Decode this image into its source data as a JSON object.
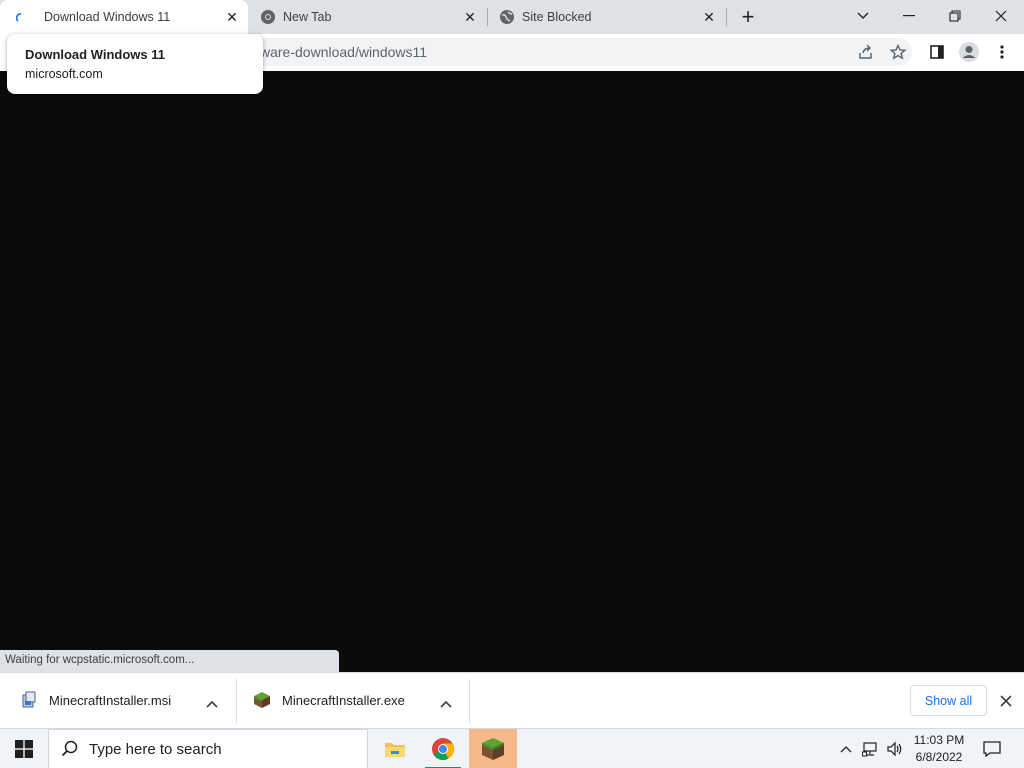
{
  "browser": {
    "tabs": [
      {
        "title": "Download Windows 11",
        "active": true,
        "icon": "loading-spinner-icon"
      },
      {
        "title": "New Tab",
        "active": false,
        "icon": "chrome-icon"
      },
      {
        "title": "Site Blocked",
        "active": false,
        "icon": "globe-icon"
      }
    ],
    "new_tab_symbol": "+",
    "close_symbol": "✕",
    "address_partial": "ware-download/windows11",
    "hover_card": {
      "title": "Download Windows 11",
      "domain": "microsoft.com"
    },
    "status_text": "Waiting for wcpstatic.microsoft.com..."
  },
  "downloads": {
    "items": [
      {
        "name": "MinecraftInstaller.msi",
        "icon": "msi-package-icon"
      },
      {
        "name": "MinecraftInstaller.exe",
        "icon": "minecraft-block-icon"
      }
    ],
    "show_all_label": "Show all"
  },
  "taskbar": {
    "search_placeholder": "Type here to search",
    "apps": [
      {
        "name": "file-explorer-icon",
        "active": false
      },
      {
        "name": "chrome-icon",
        "active": false,
        "running": true
      },
      {
        "name": "minecraft-icon",
        "active": true
      }
    ],
    "clock": {
      "time": "11:03 PM",
      "date": "6/8/2022"
    }
  },
  "colors": {
    "tabstrip_bg": "#dee1e6",
    "content_bg": "#0b0b0b",
    "accent": "#1a73e8",
    "taskbar_bg": "#f0f3f8",
    "active_taskbar_app": "#f5b888"
  }
}
